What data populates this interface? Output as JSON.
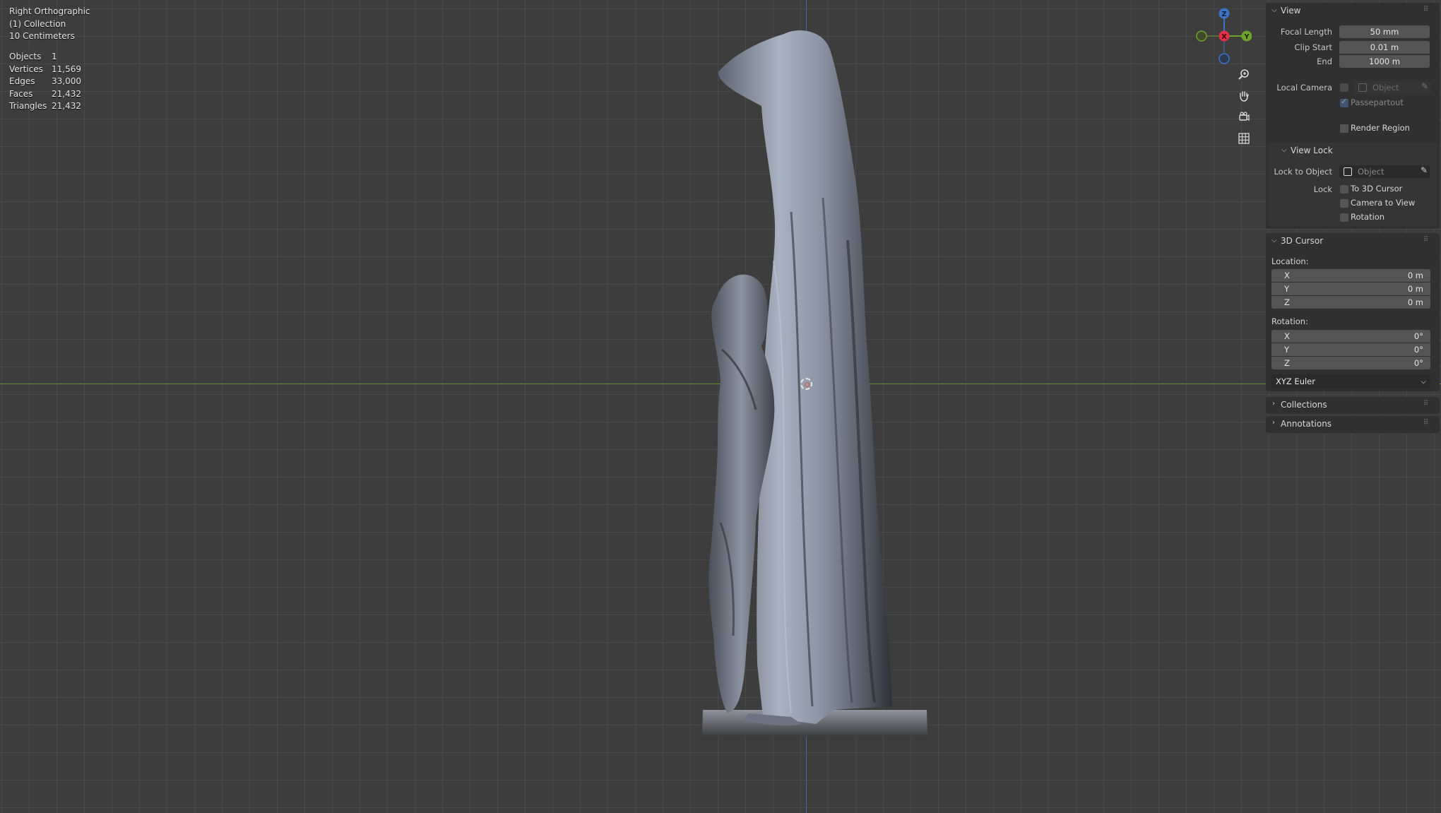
{
  "viewport": {
    "view_name": "Right Orthographic",
    "collection": "(1) Collection",
    "grid_scale": "10 Centimeters",
    "stats": [
      {
        "label": "Objects",
        "value": "1"
      },
      {
        "label": "Vertices",
        "value": "11,569"
      },
      {
        "label": "Edges",
        "value": "33,000"
      },
      {
        "label": "Faces",
        "value": "21,432"
      },
      {
        "label": "Triangles",
        "value": "21,432"
      }
    ],
    "gizmo": {
      "z": "Z",
      "x": "X",
      "y": "Y"
    },
    "colors": {
      "x_axis": "#e0304a",
      "y_axis": "#6fa32a",
      "z_axis": "#3d74c4",
      "grid_bg": "#3d3d3d"
    }
  },
  "sidebar": {
    "view_panel": {
      "title": "View",
      "focal_length_label": "Focal Length",
      "focal_length": "50 mm",
      "clip_start_label": "Clip Start",
      "clip_start": "0.01 m",
      "end_label": "End",
      "end": "1000 m",
      "local_camera_label": "Local Camera",
      "local_camera_placeholder": "Object",
      "passepartout_label": "Passepartout",
      "render_region_label": "Render Region"
    },
    "view_lock": {
      "title": "View Lock",
      "lock_to_object_label": "Lock to Object",
      "lock_to_object_placeholder": "Object",
      "lock_label": "Lock",
      "to_3d_cursor": "To 3D Cursor",
      "camera_to_view": "Camera to View",
      "rotation": "Rotation"
    },
    "cursor_panel": {
      "title": "3D Cursor",
      "location_label": "Location:",
      "location": [
        {
          "axis": "X",
          "value": "0 m"
        },
        {
          "axis": "Y",
          "value": "0 m"
        },
        {
          "axis": "Z",
          "value": "0 m"
        }
      ],
      "rotation_label": "Rotation:",
      "rotation": [
        {
          "axis": "X",
          "value": "0°"
        },
        {
          "axis": "Y",
          "value": "0°"
        },
        {
          "axis": "Z",
          "value": "0°"
        }
      ],
      "rotation_mode": "XYZ Euler"
    },
    "collections_title": "Collections",
    "annotations_title": "Annotations"
  }
}
